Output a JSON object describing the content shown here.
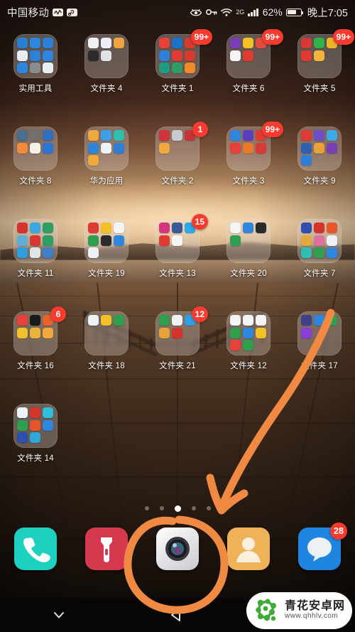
{
  "status_bar": {
    "carrier": "中国移动",
    "icons": [
      "signal-wave-icon",
      "link-icon",
      "eye-icon",
      "vpn-key-icon",
      "wifi-icon"
    ],
    "network_type": "2G",
    "battery_percent": "62%",
    "battery_level": 62,
    "time": "晚上7:05"
  },
  "home": {
    "rows": [
      {
        "cells": [
          {
            "label": "实用工具",
            "badge": "",
            "icon_count": 9,
            "colors": [
              "#2a7fd4",
              "#2f86de",
              "#2b7fd6",
              "#e9eef4",
              "#2d82d8",
              "#2f86de",
              "#2e85dd",
              "#8c8c8c",
              "#e9eef4"
            ]
          },
          {
            "label": "文件夹 4",
            "badge": "",
            "icon_count": 5,
            "colors": [
              "#f0f0f2",
              "#eceffa",
              "#efa43d",
              "#2b2b2b",
              "#dfe3e6"
            ]
          },
          {
            "label": "文件夹 1",
            "badge": "99+",
            "icon_count": 9,
            "colors": [
              "#e8413a",
              "#1a73c8",
              "#d83c2f",
              "#2f7ed8",
              "#e03b32",
              "#d93a2f",
              "#1f9b84",
              "#2f9e63",
              "#ef8a2a"
            ]
          },
          {
            "label": "文件夹 6",
            "badge": "99+",
            "icon_count": 5,
            "colors": [
              "#7b3fb5",
              "#f2c027",
              "#e14d3a",
              "#f4f4f4",
              "#e03b32"
            ]
          },
          {
            "label": "文件夹 5",
            "badge": "99+",
            "icon_count": 5,
            "colors": [
              "#d63a36",
              "#2fb14c",
              "#f0b429",
              "#e03b32",
              "#f2b43a"
            ]
          }
        ]
      },
      {
        "cells": [
          {
            "label": "文件夹 8",
            "badge": "",
            "icon_count": 6,
            "colors": [
              "#4a6f8c",
              "#707070",
              "#2f6fc0",
              "#f08b3c",
              "#f7f2e8",
              "#2d74d4"
            ]
          },
          {
            "label": "华为应用",
            "badge": "",
            "icon_count": 7,
            "colors": [
              "#f0a93c",
              "#3aa0e8",
              "#2fbfb0",
              "#2f86d8",
              "#eef3f7",
              "#2f7ed8",
              "#efa93c"
            ]
          },
          {
            "label": "文件夹 2",
            "badge": "1",
            "icon_count": 4,
            "colors": [
              "#d0343a",
              "#c8ccd0",
              "#c8343a",
              "#f0a93c"
            ]
          },
          {
            "label": "文件夹 3",
            "badge": "99+",
            "icon_count": 6,
            "colors": [
              "#2f86de",
              "#5b3fc0",
              "#e03b32",
              "#e8413a",
              "#e87a2a",
              "#d63a36"
            ]
          },
          {
            "label": "文件夹 9",
            "badge": "",
            "icon_count": 7,
            "colors": [
              "#e03b32",
              "#6f4fc8",
              "#3fa9e8",
              "#2f5fb0",
              "#e8a23a",
              "#7b3fb5",
              "#2f7ed8"
            ]
          }
        ]
      },
      {
        "cells": [
          {
            "label": "文件夹 11",
            "badge": "",
            "icon_count": 9,
            "colors": [
              "#d6322e",
              "#3aa8e0",
              "#2f9e63",
              "#5fb0d8",
              "#d8382f",
              "#2f9e63",
              "#2f9ee0",
              "#e0e4e8",
              "#3f7fc8"
            ]
          },
          {
            "label": "文件夹 19",
            "badge": "",
            "icon_count": 7,
            "colors": [
              "#e03b32",
              "#f2c027",
              "#f4f4f4",
              "#2f9e4e",
              "#2b2b2b",
              "#2f86de",
              "#eef2f6"
            ]
          },
          {
            "label": "文件夹 13",
            "badge": "15",
            "icon_count": 5,
            "colors": [
              "#d6357f",
              "#3b5998",
              "#2fa8e8",
              "#e03b32",
              "#f4f4f4"
            ]
          },
          {
            "label": "文件夹 20",
            "badge": "",
            "icon_count": 4,
            "colors": [
              "#f4f4f4",
              "#2f86de",
              "#2b2b2b",
              "#2f9e4e"
            ]
          },
          {
            "label": "文件夹 7",
            "badge": "",
            "icon_count": 9,
            "colors": [
              "#2f4fb0",
              "#d6322e",
              "#e8552a",
              "#e0a93a",
              "#e06fa0",
              "#eef2f6",
              "#2fbfb0",
              "#2f9e4e",
              "#2f86de"
            ]
          }
        ]
      },
      {
        "cells": [
          {
            "label": "文件夹 16",
            "badge": "6",
            "icon_count": 6,
            "colors": [
              "#e8413a",
              "#1a1a1a",
              "#e8622a",
              "#f2c027",
              "#e8b43a",
              "#f0a93c"
            ]
          },
          {
            "label": "文件夹 18",
            "badge": "",
            "icon_count": 3,
            "colors": [
              "#eef2f6",
              "#f2c027",
              "#2f9e4e"
            ]
          },
          {
            "label": "文件夹 21",
            "badge": "12",
            "icon_count": 5,
            "colors": [
              "#2f9e4e",
              "#eef2f6",
              "#2fa0e8",
              "#e8a23a",
              "#d6322e"
            ]
          },
          {
            "label": "文件夹 12",
            "badge": "",
            "icon_count": 8,
            "colors": [
              "#f4f4f4",
              "#f4f4f4",
              "#f4f4f4",
              "#2f9e4e",
              "#2f86de",
              "#f2c027",
              "#e8413a",
              "#2f9e4e"
            ]
          },
          {
            "label": "文件夹 17",
            "badge": "",
            "icon_count": 4,
            "colors": [
              "#3f3f8c",
              "#2f86de",
              "#2f9e4e",
              "#8c3fd8"
            ]
          }
        ]
      },
      {
        "cells": [
          {
            "label": "文件夹 14",
            "badge": "",
            "icon_count": 8,
            "colors": [
              "#eef2f6",
              "#d6322e",
              "#2fbfd8",
              "#2f9e4e",
              "#e8552a",
              "#2f86de",
              "#2f4fb0",
              "#2fa8d8"
            ]
          }
        ]
      }
    ]
  },
  "page_indicator": {
    "count": 5,
    "active_index": 2
  },
  "dock": {
    "items": [
      {
        "name": "phone",
        "icon": "phone-icon",
        "color": "#1ed0c0",
        "badge": ""
      },
      {
        "name": "flashlight",
        "icon": "flashlight-icon",
        "color": "#d6384e",
        "badge": ""
      },
      {
        "name": "camera",
        "icon": "camera-icon",
        "color": "#e8e8ea",
        "badge": ""
      },
      {
        "name": "contacts",
        "icon": "contacts-icon",
        "color": "#f0b259",
        "badge": ""
      },
      {
        "name": "messages",
        "icon": "messages-icon",
        "color": "#1e86e0",
        "badge": "28"
      }
    ]
  },
  "annotation": {
    "color": "#f08a42",
    "target": "camera"
  },
  "navbar": {
    "buttons": [
      {
        "name": "hide-navbar",
        "icon": "chevron-down-icon"
      },
      {
        "name": "back",
        "icon": "back-triangle-icon"
      },
      {
        "name": "home",
        "icon": "home-circle-icon"
      }
    ]
  },
  "watermark": {
    "site_cn": "青花安卓网",
    "url": "www.qhhlv.com"
  }
}
